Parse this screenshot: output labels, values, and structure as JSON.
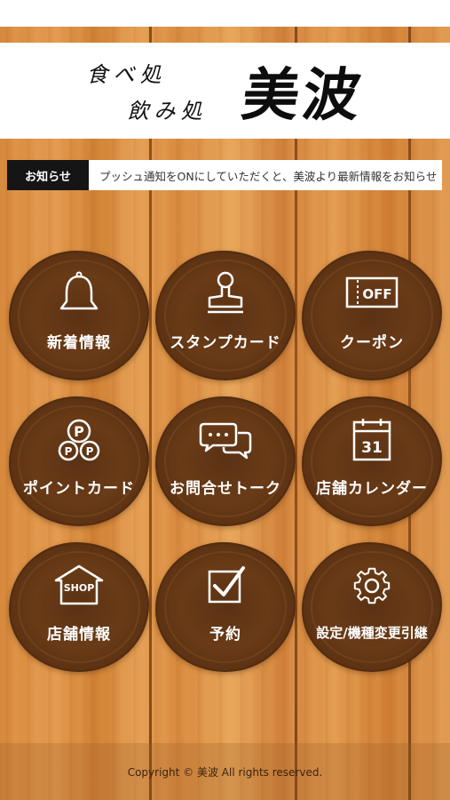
{
  "header": {
    "logo_small_line1": "食べ処",
    "logo_small_line2": "飲み処",
    "logo_name": "美波"
  },
  "notice": {
    "label": "お知らせ",
    "text": "プッシュ通知をONにしていただくと、美波より最新情報をお知らせ"
  },
  "menu": [
    {
      "label": "新着情報",
      "icon": "bell-icon"
    },
    {
      "label": "スタンプカード",
      "icon": "stamp-icon"
    },
    {
      "label": "クーポン",
      "icon": "coupon-icon",
      "icon_text": "OFF"
    },
    {
      "label": "ポイントカード",
      "icon": "points-icon",
      "icon_text": "P"
    },
    {
      "label": "お問合せトーク",
      "icon": "chat-icon"
    },
    {
      "label": "店舗カレンダー",
      "icon": "calendar-icon",
      "icon_text": "31"
    },
    {
      "label": "店舗情報",
      "icon": "shop-icon",
      "icon_text": "SHOP"
    },
    {
      "label": "予約",
      "icon": "checkbox-icon"
    },
    {
      "label": "設定/機種変更引継",
      "icon": "gear-icon"
    }
  ],
  "footer": {
    "copyright": "Copyright © 美波 All rights reserved."
  }
}
